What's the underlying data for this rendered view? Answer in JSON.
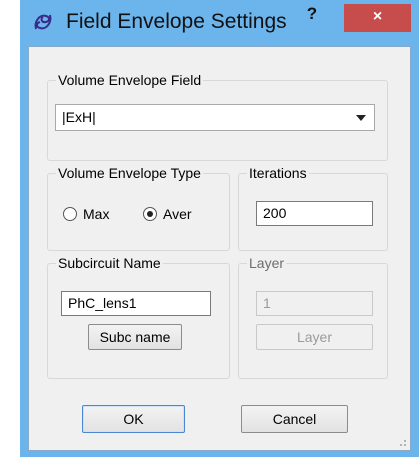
{
  "window": {
    "title": "Field Envelope Settings",
    "help_label": "?",
    "close_label": "×",
    "title_icon": "propeller-icon",
    "accent_color": "#6bb4ec",
    "close_color": "#c74c4c"
  },
  "volume_envelope_field": {
    "group_label": "Volume Envelope Field",
    "selected_value": "|ExH|"
  },
  "volume_envelope_type": {
    "group_label": "Volume Envelope Type",
    "options": [
      {
        "label": "Max",
        "selected": false
      },
      {
        "label": "Aver",
        "selected": true
      }
    ]
  },
  "iterations": {
    "group_label": "Iterations",
    "value": "200"
  },
  "subcircuit": {
    "group_label": "Subcircuit Name",
    "value": "PhC_lens1",
    "button_label": "Subc name"
  },
  "layer": {
    "group_label": "Layer",
    "value": "1",
    "button_label": "Layer",
    "enabled": false
  },
  "footer": {
    "ok_label": "OK",
    "cancel_label": "Cancel"
  }
}
